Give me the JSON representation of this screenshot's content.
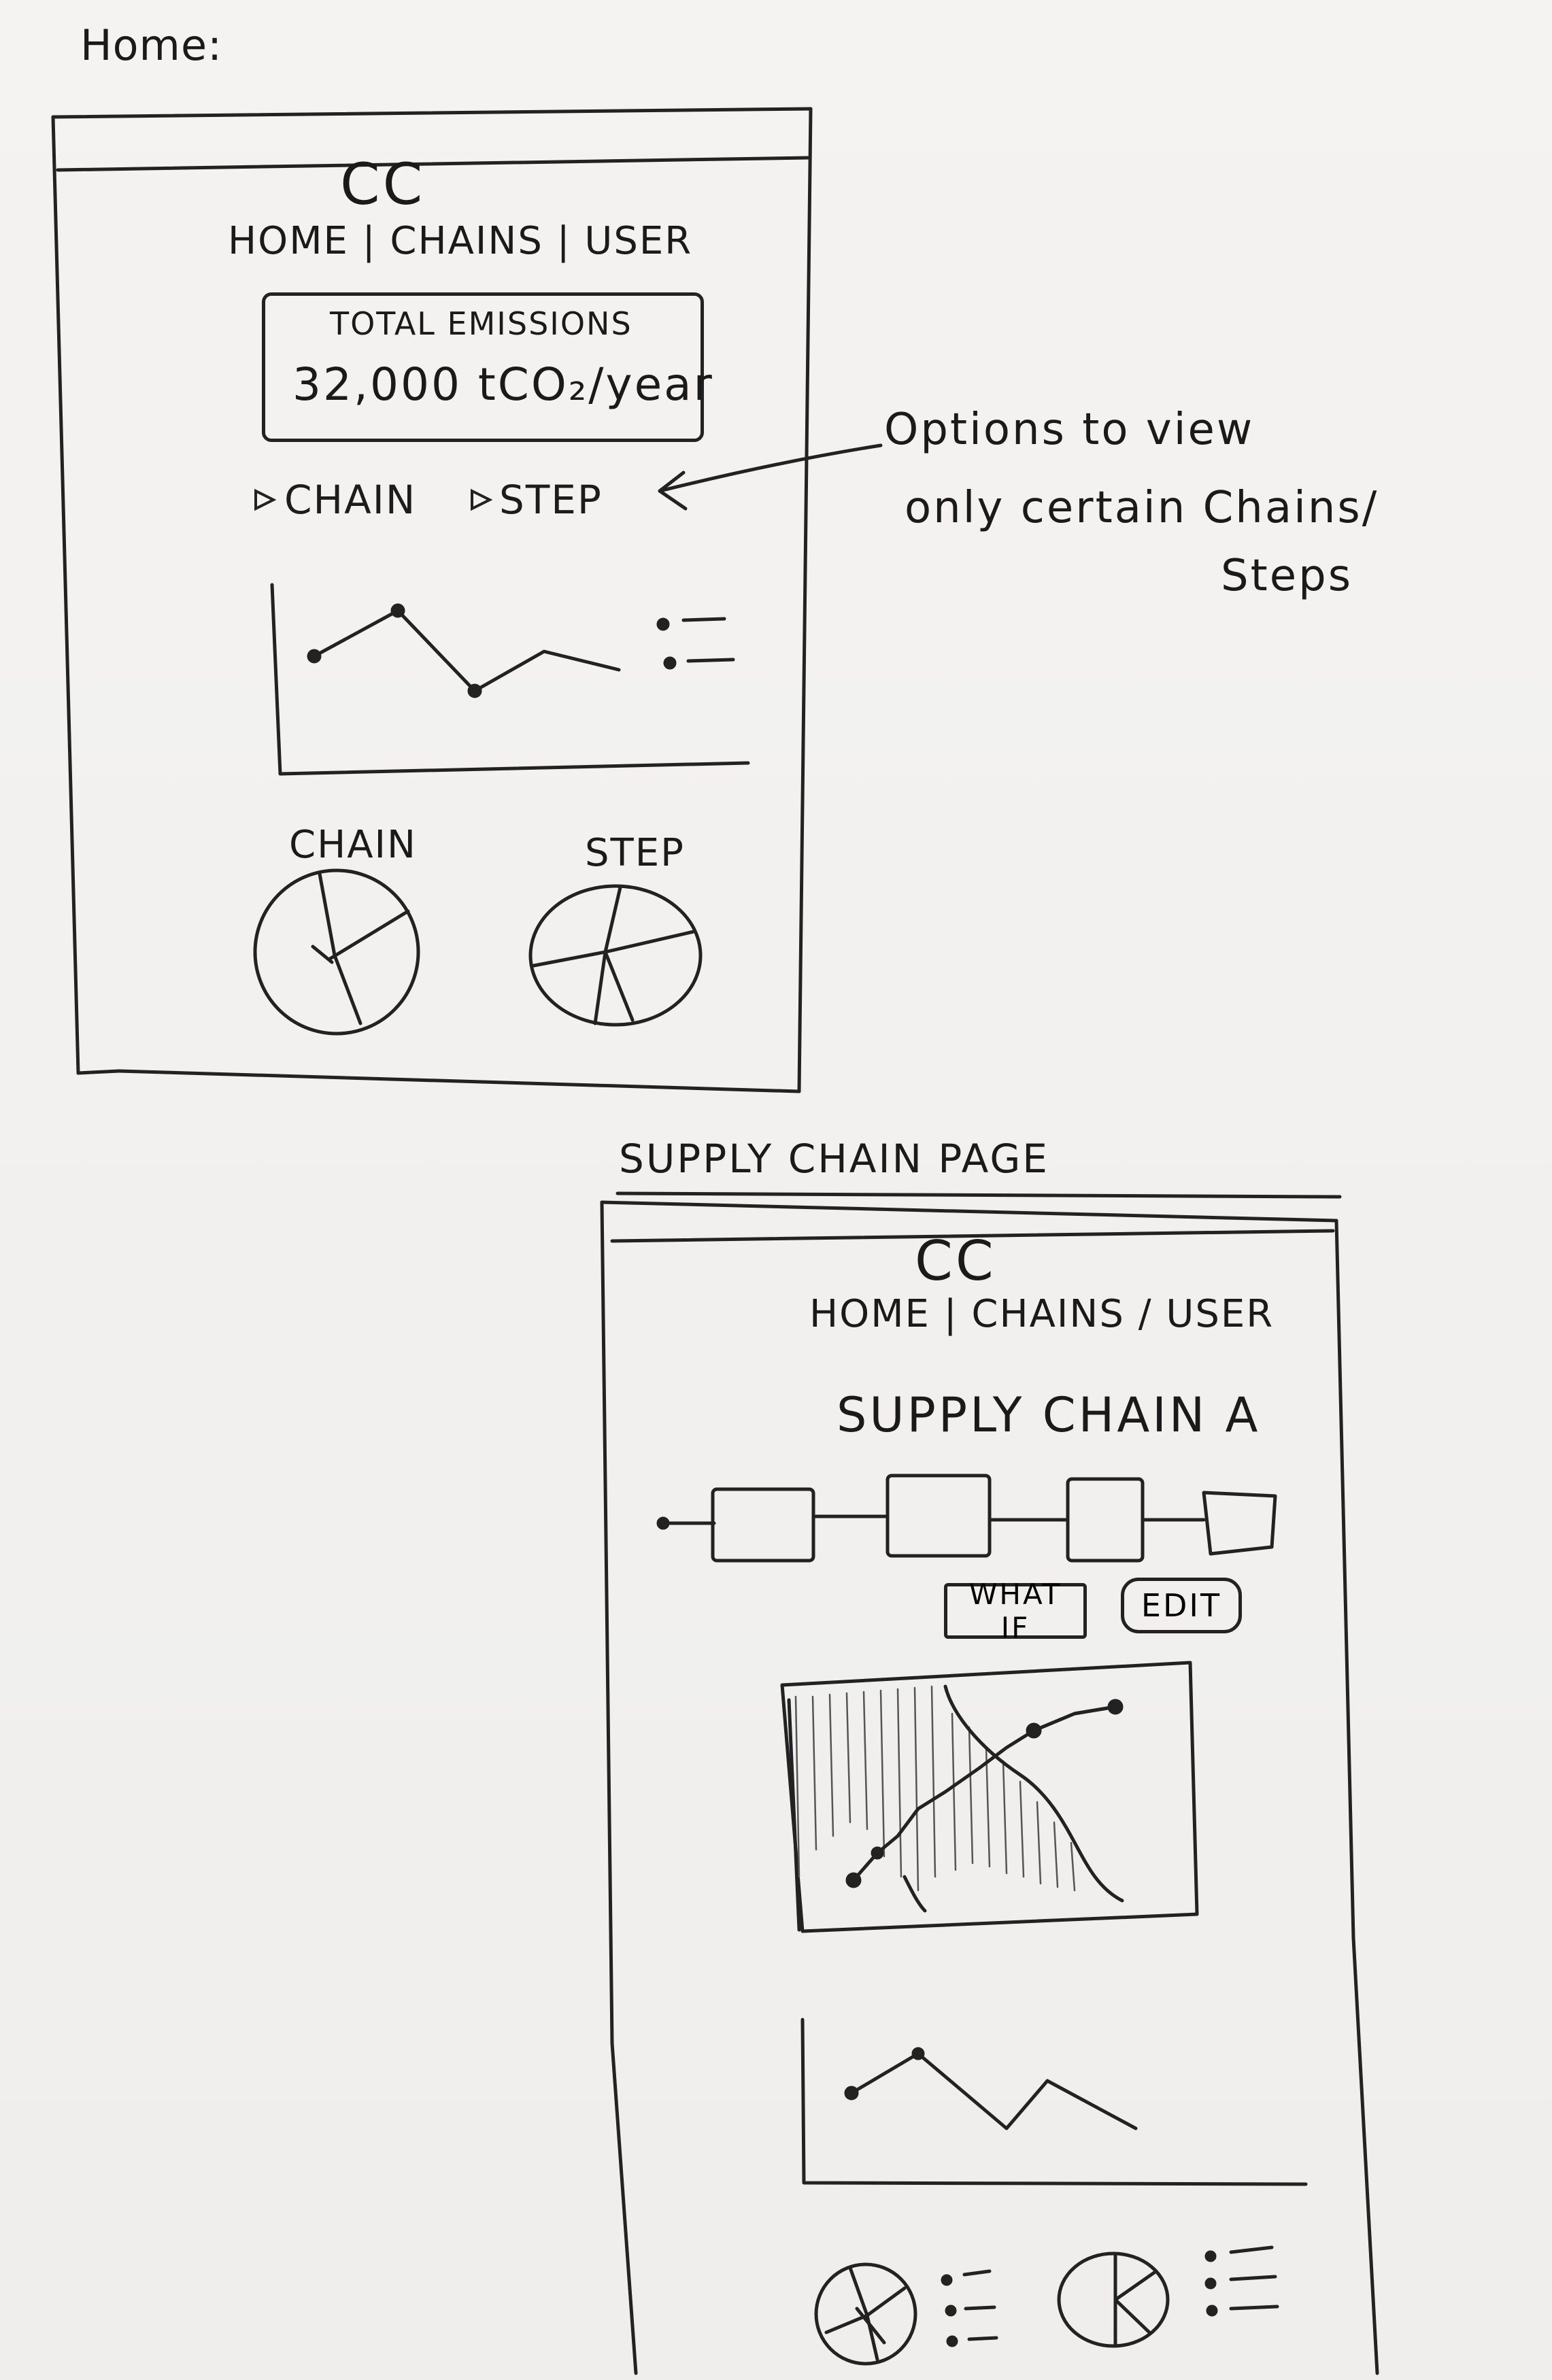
{
  "home": {
    "section_label": "Home:",
    "app_logo": "CC",
    "nav": {
      "home": "HOME",
      "sep1": "|",
      "chains": "CHAINS",
      "sep2": "|",
      "user": "USER"
    },
    "emissions_card": {
      "label": "TOTAL EMISSIONS",
      "value": "32,000 tCO₂/year"
    },
    "filters": {
      "chain": "CHAIN",
      "step": "STEP"
    },
    "pie_labels": {
      "chain": "CHAIN",
      "step": "STEP"
    }
  },
  "annotation": {
    "line1": "Options to view",
    "line2": "only certain Chains/",
    "line3": "Steps"
  },
  "supply": {
    "section_label": "SUPPLY CHAIN PAGE",
    "app_logo": "CC",
    "nav": {
      "home": "HOME",
      "sep1": "|",
      "chains": "CHAINS",
      "sep2": "/",
      "user": "USER"
    },
    "title": "SUPPLY CHAIN A",
    "buttons": {
      "what_if": "WHAT IF",
      "edit": "EDIT"
    }
  },
  "icons": {
    "filter_chain": "triangle-right-icon",
    "filter_step": "triangle-right-icon",
    "arrow": "arrow-left-icon"
  }
}
